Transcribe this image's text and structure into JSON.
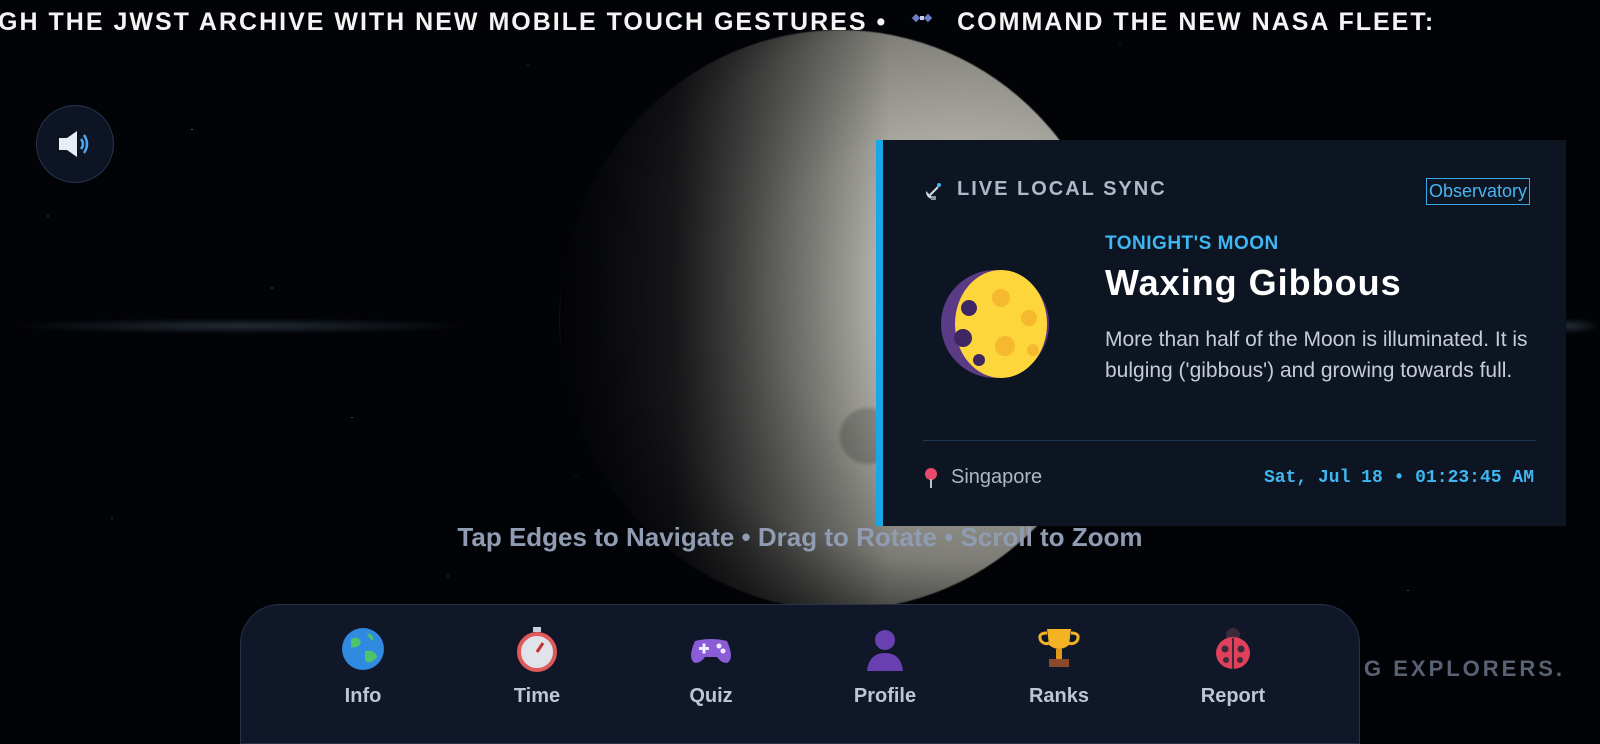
{
  "ticker": {
    "segment1": "UGH THE JWST ARCHIVE WITH NEW MOBILE TOUCH GESTURES •",
    "segment2": "COMMAND THE NEW NASA FLEET:",
    "satellite_icon": "satellite-icon"
  },
  "sound_button": {
    "icon": "speaker-icon"
  },
  "sync_card": {
    "title": "LIVE LOCAL SYNC",
    "observatory_label": "Observatory",
    "moon_label": "TONIGHT'S MOON",
    "phase": "Waxing Gibbous",
    "description": "More than half of the Moon is illuminated. It is bulging ('gibbous') and growing towards full.",
    "location": "Singapore",
    "datetime": "Sat, Jul 18 • 01:23:45 AM",
    "accent_color": "#1aa7e6"
  },
  "hint": "Tap Edges to Navigate • Drag to Rotate • Scroll to Zoom",
  "nav": {
    "items": [
      {
        "label": "Info",
        "icon": "globe-icon"
      },
      {
        "label": "Time",
        "icon": "stopwatch-icon"
      },
      {
        "label": "Quiz",
        "icon": "gamepad-icon"
      },
      {
        "label": "Profile",
        "icon": "person-icon"
      },
      {
        "label": "Ranks",
        "icon": "trophy-icon"
      },
      {
        "label": "Report",
        "icon": "ladybug-icon"
      }
    ]
  },
  "footer_text": "G EXPLORERS."
}
